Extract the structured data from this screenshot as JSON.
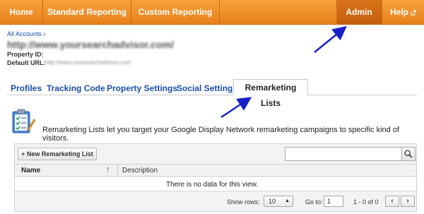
{
  "nav": {
    "home": "Home",
    "standard_reporting": "Standard Reporting",
    "custom_reporting": "Custom Reporting",
    "admin": "Admin",
    "help": "Help"
  },
  "property": {
    "breadcrumb": "All Accounts",
    "breadcrumb_sep": "›",
    "url_blurred": "http://www.yoursearchadvisor.com/",
    "property_id_label": "Property ID:",
    "default_url_label": "Default URL:",
    "default_url_value_blurred": "http://www.yoursearchadvisor.com"
  },
  "tabs": [
    {
      "label": "Profiles"
    },
    {
      "label": "Tracking Code"
    },
    {
      "label": "Property Settings"
    },
    {
      "label": "Social Settings"
    },
    {
      "label": "Remarketing Lists",
      "active": true
    }
  ],
  "info": {
    "text": "Remarketing Lists let you target your Google Display Network remarketing campaigns to specific kind of visitors."
  },
  "table": {
    "new_button": "+ New Remarketing List",
    "search_value": "",
    "columns": [
      "Name",
      "Description"
    ],
    "sort_arrow": "↑",
    "empty_message": "There is no data for this view.",
    "show_rows_label": "Show rows:",
    "rows_value": "10",
    "goto_label": "Go to:",
    "goto_value": "1",
    "page_range": "1 - 0 of 0",
    "prev": "‹",
    "next": "›"
  },
  "colors": {
    "nav_orange": "#e8801a",
    "link_blue": "#1a4ea8",
    "annotation_arrow": "#1620c8"
  }
}
